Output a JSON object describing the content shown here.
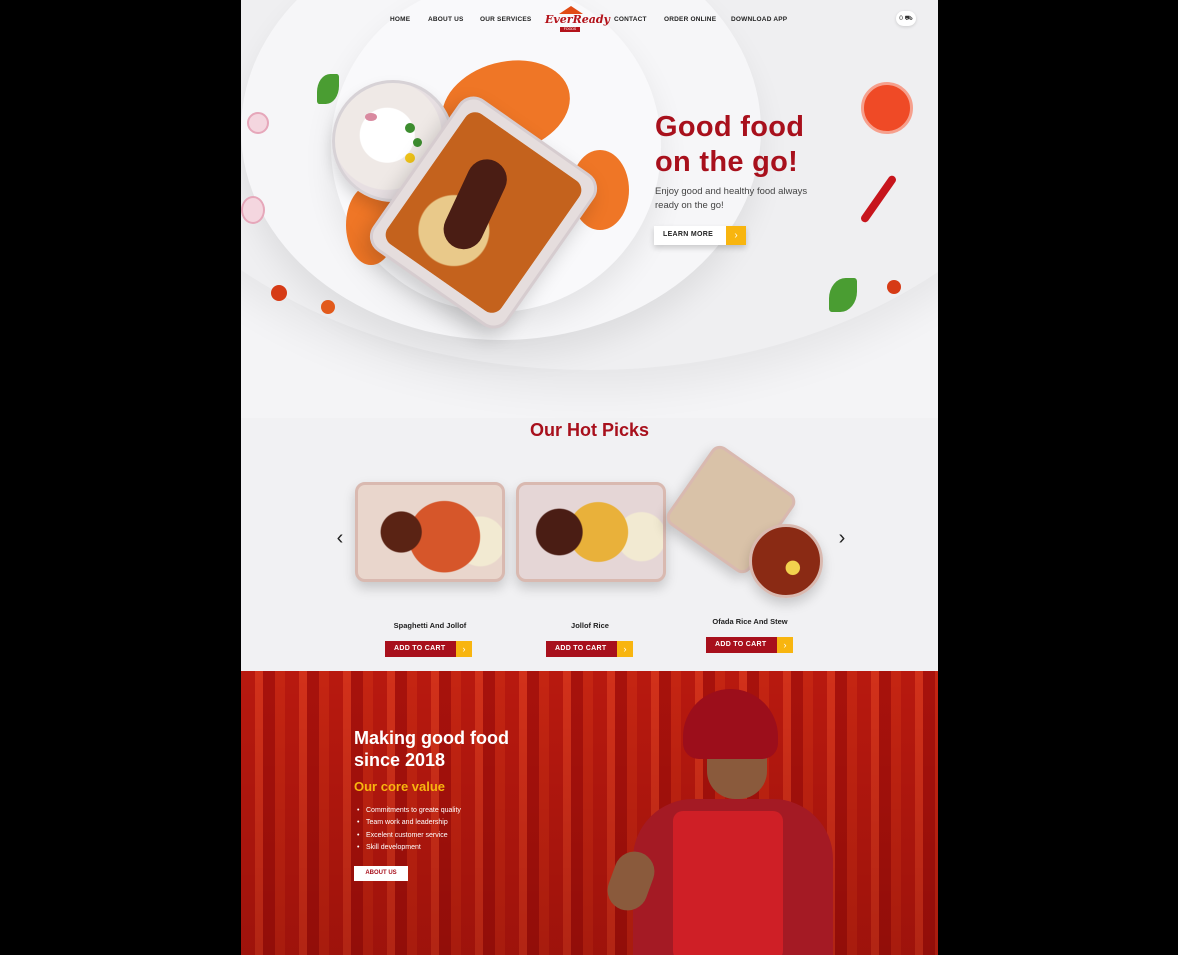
{
  "nav": {
    "home": "HOME",
    "about": "ABOUT US",
    "services": "OUR SERVICES",
    "contact": "CONTACT",
    "order": "ORDER ONLINE",
    "download": "DOWNLOAD APP",
    "logo_text": "EverReady",
    "logo_sub": "FOODS",
    "cart_count": "0"
  },
  "hero": {
    "headline_1": "Good food",
    "headline_2": "on the go!",
    "subtitle": "Enjoy good and healthy food always ready on the go!",
    "cta_label": "LEARN MORE",
    "cta_icon": "chevron-right-icon"
  },
  "hot_picks": {
    "title": "Our Hot Picks",
    "prev_icon": "chevron-left-icon",
    "next_icon": "chevron-right-icon",
    "products": [
      {
        "name": "Spaghetti And Jollof",
        "button": "ADD TO CART"
      },
      {
        "name": "Jollof Rice",
        "button": "ADD TO CART"
      },
      {
        "name": "Ofada Rice And Stew",
        "button": "ADD TO CART"
      }
    ]
  },
  "about": {
    "title_1": "Making good food",
    "title_2": "since 2018",
    "subtitle": "Our core value",
    "values": [
      "Commitments to greate quality",
      "Team work and leadership",
      "Excelent customer service",
      "Skill development"
    ],
    "button": "ABOUT US"
  },
  "colors": {
    "brand_red": "#a8101c",
    "accent_yellow": "#f8b50f",
    "accent_orange": "#ee6a14"
  }
}
